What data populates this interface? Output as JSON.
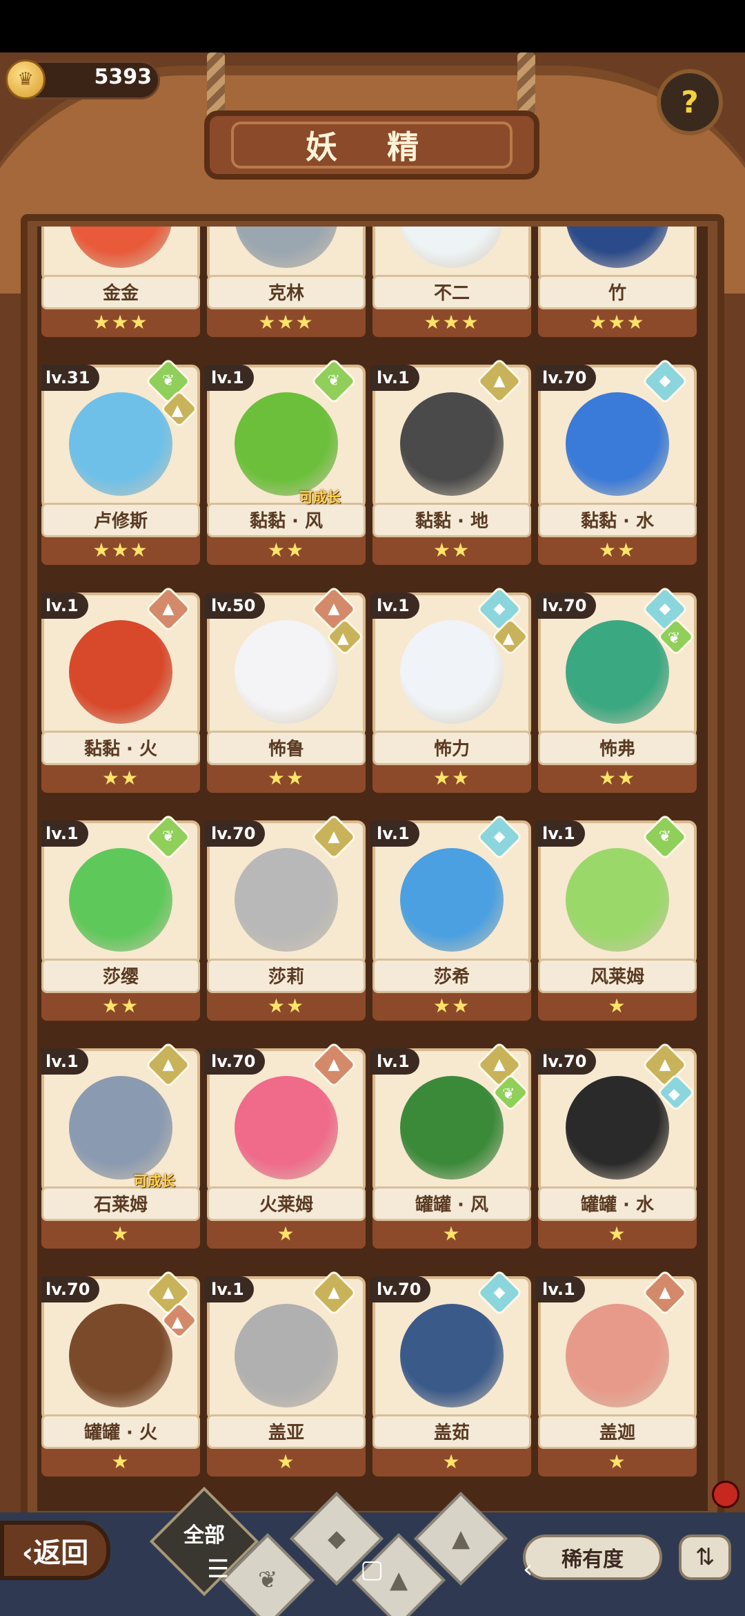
{
  "header": {
    "title": "妖 精",
    "coins": "5393",
    "help_glyph": "?"
  },
  "bottom": {
    "back_label": "‹返回",
    "filter_all_label": "全部",
    "rarity_label": "稀有度",
    "sort_glyph": "⇅",
    "nav": {
      "menu": "☰",
      "home": "▢",
      "back": "‹"
    }
  },
  "cards": [
    {
      "name": "金金",
      "level": "",
      "stars": "★★★",
      "elements": []
    },
    {
      "name": "克林",
      "level": "",
      "stars": "★★★",
      "elements": []
    },
    {
      "name": "不二",
      "level": "",
      "stars": "★★★",
      "elements": []
    },
    {
      "name": "竹",
      "level": "",
      "stars": "★★★",
      "elements": []
    },
    {
      "name": "卢修斯",
      "level": "lv.31",
      "stars": "★★★",
      "elements": [
        "wind",
        "earth"
      ]
    },
    {
      "name": "黏黏 · 风",
      "level": "lv.1",
      "stars": "★★",
      "elements": [
        "wind"
      ],
      "tag": "可成长"
    },
    {
      "name": "黏黏 · 地",
      "level": "lv.1",
      "stars": "★★",
      "elements": [
        "earth"
      ]
    },
    {
      "name": "黏黏 · 水",
      "level": "lv.70",
      "stars": "★★",
      "elements": [
        "water"
      ]
    },
    {
      "name": "黏黏 · 火",
      "level": "lv.1",
      "stars": "★★",
      "elements": [
        "fire"
      ]
    },
    {
      "name": "怖鲁",
      "level": "lv.50",
      "stars": "★★",
      "elements": [
        "fire",
        "earth"
      ]
    },
    {
      "name": "怖力",
      "level": "lv.1",
      "stars": "★★",
      "elements": [
        "water",
        "earth"
      ]
    },
    {
      "name": "怖弗",
      "level": "lv.70",
      "stars": "★★",
      "elements": [
        "water",
        "wind"
      ]
    },
    {
      "name": "莎缨",
      "level": "lv.1",
      "stars": "★★",
      "elements": [
        "wind"
      ]
    },
    {
      "name": "莎莉",
      "level": "lv.70",
      "stars": "★★",
      "elements": [
        "earth"
      ]
    },
    {
      "name": "莎希",
      "level": "lv.1",
      "stars": "★★",
      "elements": [
        "water"
      ]
    },
    {
      "name": "风莱姆",
      "level": "lv.1",
      "stars": "★",
      "elements": [
        "wind"
      ]
    },
    {
      "name": "石莱姆",
      "level": "lv.1",
      "stars": "★",
      "elements": [
        "earth"
      ],
      "tag": "可成长"
    },
    {
      "name": "火莱姆",
      "level": "lv.70",
      "stars": "★",
      "elements": [
        "fire"
      ]
    },
    {
      "name": "罐罐 · 风",
      "level": "lv.1",
      "stars": "★",
      "elements": [
        "earth",
        "wind"
      ]
    },
    {
      "name": "罐罐 · 水",
      "level": "lv.70",
      "stars": "★",
      "elements": [
        "earth",
        "water"
      ]
    },
    {
      "name": "罐罐 · 火",
      "level": "lv.70",
      "stars": "★",
      "elements": [
        "earth",
        "fire"
      ]
    },
    {
      "name": "盖亚",
      "level": "lv.1",
      "stars": "★",
      "elements": [
        "earth"
      ]
    },
    {
      "name": "盖茹",
      "level": "lv.70",
      "stars": "★",
      "elements": [
        "water"
      ]
    },
    {
      "name": "盖迦",
      "level": "lv.1",
      "stars": "★",
      "elements": [
        "fire"
      ]
    }
  ],
  "element_colors": {
    "wind": "#8fcf5a",
    "earth": "#c9b35a",
    "water": "#8ad6dc",
    "fire": "#d48a6a"
  },
  "element_icons": {
    "wind": "❦",
    "earth": "▲",
    "water": "◆",
    "fire": "▲"
  }
}
